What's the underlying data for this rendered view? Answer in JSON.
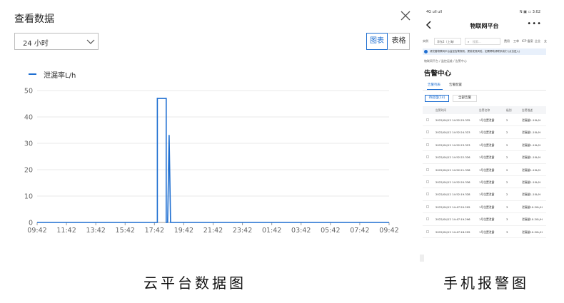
{
  "dialog": {
    "title": "查看数据",
    "range_select": "24 小时",
    "btn_chart": "图表",
    "btn_table": "表格",
    "legend": "泄漏率L/h"
  },
  "chart_data": {
    "type": "line",
    "series": [
      {
        "name": "泄漏率L/h",
        "color": "#1f6fd1",
        "points": [
          [
            0,
            0
          ],
          [
            1,
            0
          ],
          [
            2,
            0
          ],
          [
            3,
            0
          ],
          [
            4,
            0
          ],
          [
            4.0,
            0
          ],
          [
            4.1,
            0
          ],
          [
            4.1,
            47
          ],
          [
            4.4,
            47
          ],
          [
            4.4,
            0
          ],
          [
            4.45,
            0
          ],
          [
            4.5,
            33
          ],
          [
            4.55,
            0
          ],
          [
            5,
            0
          ],
          [
            6,
            0
          ],
          [
            7,
            0
          ],
          [
            8,
            0
          ],
          [
            9,
            0
          ],
          [
            10,
            0
          ],
          [
            11,
            0
          ],
          [
            12,
            0
          ]
        ]
      }
    ],
    "x_ticks": [
      "09:42",
      "11:42",
      "13:42",
      "15:42",
      "17:42",
      "19:42",
      "21:42",
      "23:42",
      "01:42",
      "03:42",
      "05:42",
      "07:42",
      "09:42"
    ],
    "y_ticks": [
      0,
      10,
      20,
      30,
      40,
      50
    ],
    "ylim": [
      0,
      50
    ],
    "grid": true
  },
  "phone": {
    "status_left": "4G ull ull",
    "status_right": "N ▣ ▭ 3:02",
    "title": "物联网平台",
    "more": "•••",
    "filter": {
      "label": "实例",
      "select": "华东2（上海）",
      "search_ph": "搜索...",
      "links": [
        "费用",
        "工单",
        "ICP 备案",
        "企业",
        "支"
      ]
    },
    "notice": "请完善物联网平台监控告警规则，提前发现风险，如需帮助请联系我们 (点击进入)",
    "breadcrumb": "物联网平台 / 监控运维 / 告警中心",
    "page_title": "告警中心",
    "tabs": [
      "告警列表",
      "告警配置"
    ],
    "pills": [
      "待处理(14)",
      "全部告警"
    ],
    "columns": [
      "告警时间",
      "告警名称",
      "级别",
      "告警描述"
    ],
    "rows": [
      [
        "2022/04/12 14:52:25.335",
        "1号位置泄露",
        "2",
        "泄漏量1-10L/H"
      ],
      [
        "2022/04/12 14:52:24.323",
        "1号位置泄露",
        "2",
        "泄漏量1-10L/H"
      ],
      [
        "2022/04/12 14:52:23.323",
        "1号位置泄露",
        "2",
        "泄漏量1-10L/H"
      ],
      [
        "2022/04/12 14:52:22.326",
        "1号位置泄露",
        "2",
        "泄漏量1-10L/H"
      ],
      [
        "2022/04/12 14:52:21.336",
        "1号位置泄露",
        "2",
        "泄漏量1-10L/H"
      ],
      [
        "2022/04/12 14:52:20.336",
        "1号位置泄露",
        "2",
        "泄漏量1-10L/H"
      ],
      [
        "2022/04/12 14:52:19.328",
        "1号位置泄露",
        "2",
        "泄漏量1-10L/H"
      ],
      [
        "2022/04/12 14:47:20.295",
        "1号位置泄露",
        "3",
        "泄漏量10-20L/H"
      ],
      [
        "2022/04/12 14:47:19.296",
        "1号位置泄露",
        "3",
        "泄漏量10-20L/H"
      ],
      [
        "2022/04/12 14:47:18.295",
        "1号位置泄露",
        "3",
        "泄漏量10-20L/H"
      ]
    ]
  },
  "captions": {
    "left": "云平台数据图",
    "right": "手机报警图"
  }
}
